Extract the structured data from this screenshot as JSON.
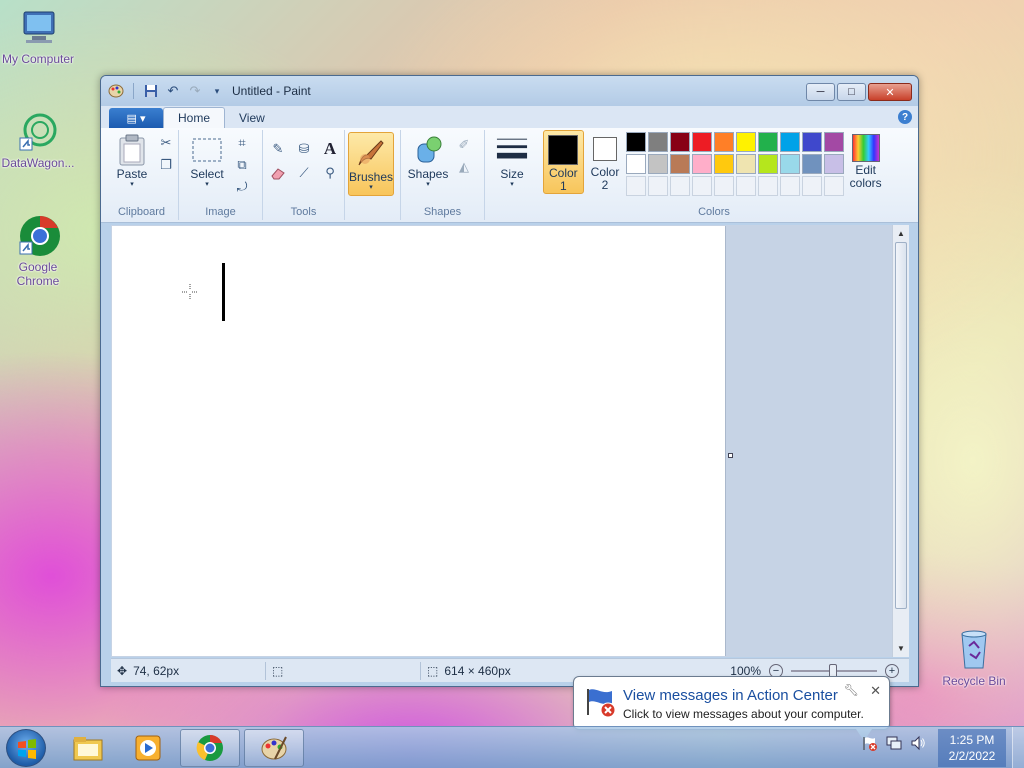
{
  "desktop": {
    "icons": [
      {
        "label": "My Computer"
      },
      {
        "label": "DataWagon..."
      },
      {
        "label": "Google Chrome"
      },
      {
        "label": "Recycle Bin"
      }
    ]
  },
  "window": {
    "title": "Untitled - Paint",
    "controls": {
      "minimize": "─",
      "maximize": "□",
      "close": "✕"
    }
  },
  "ribbon": {
    "tabs": [
      {
        "label": "Home",
        "active": true
      },
      {
        "label": "View",
        "active": false
      }
    ],
    "help": "?",
    "groups": {
      "clipboard": {
        "label": "Clipboard",
        "paste": "Paste"
      },
      "image": {
        "label": "Image",
        "select": "Select"
      },
      "tools": {
        "label": "Tools"
      },
      "brushes": {
        "label": "Brushes"
      },
      "shapes": {
        "label": "Shapes",
        "shapes_btn": "Shapes"
      },
      "size": {
        "label": "Size"
      },
      "colors": {
        "label": "Colors",
        "color1": "Color 1",
        "color2": "Color 2",
        "edit_colors": "Edit colors",
        "color1_value": "#000000",
        "color2_value": "#ffffff",
        "palette_row1": [
          "#000000",
          "#7f7f7f",
          "#880015",
          "#ed1c24",
          "#ff7f27",
          "#fff200",
          "#22b14c",
          "#00a2e8",
          "#3f48cc",
          "#a349a4"
        ],
        "palette_row2": [
          "#ffffff",
          "#c3c3c3",
          "#b97a57",
          "#ffaec9",
          "#ffc90e",
          "#efe4b0",
          "#b5e61d",
          "#99d9ea",
          "#7092be",
          "#c8bfe7"
        ]
      }
    }
  },
  "status": {
    "cursor_pos": "74, 62px",
    "selection_size": "",
    "canvas_size": "614 × 460px",
    "zoom": "100%"
  },
  "notification": {
    "title": "View messages in Action Center",
    "text": "Click to view messages about your computer."
  },
  "taskbar": {
    "clock_time": "1:25 PM",
    "clock_date": "2/2/2022"
  }
}
